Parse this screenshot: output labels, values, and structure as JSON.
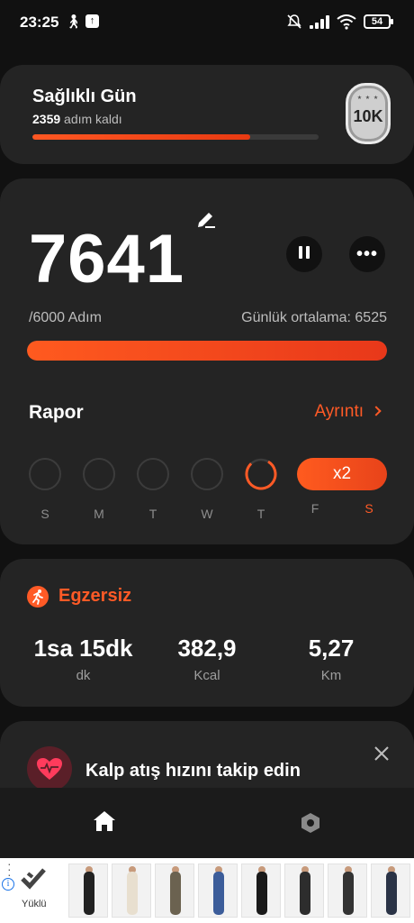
{
  "status_bar": {
    "time": "23:25",
    "battery": "54"
  },
  "healthy_day": {
    "title": "Sağlıklı Gün",
    "steps_left": "2359",
    "steps_left_suffix": " adım kaldı",
    "progress": 0.76,
    "badge": "10K"
  },
  "main": {
    "steps": "7641",
    "goal": "/6000 Adım",
    "daily_average": "Günlük ortalama: 6525",
    "progress": 1.0,
    "report_label": "Rapor",
    "detail_label": "Ayrıntı",
    "multiplier": "x2",
    "days": [
      "S",
      "M",
      "T",
      "W",
      "T",
      "F",
      "S"
    ]
  },
  "exercise": {
    "title": "Egzersiz",
    "stats": [
      {
        "value": "1sa 15dk",
        "unit": "dk"
      },
      {
        "value": "382,9",
        "unit": "Kcal"
      },
      {
        "value": "5,27",
        "unit": "Km"
      }
    ]
  },
  "heart": {
    "text": "Kalp atış hızını takip edin"
  },
  "ad": {
    "brand": "Yüklü"
  },
  "colors": {
    "accent": "#ff5a26",
    "card": "#242424",
    "background": "#111111"
  },
  "icons": [
    "walk-icon",
    "upload-icon",
    "mute-icon",
    "signal-icon",
    "wifi-icon",
    "battery-icon",
    "edit-icon",
    "pause-icon",
    "more-icon",
    "chevron-right-icon",
    "running-icon",
    "heart-icon",
    "close-icon",
    "home-icon",
    "settings-icon",
    "info-icon"
  ]
}
